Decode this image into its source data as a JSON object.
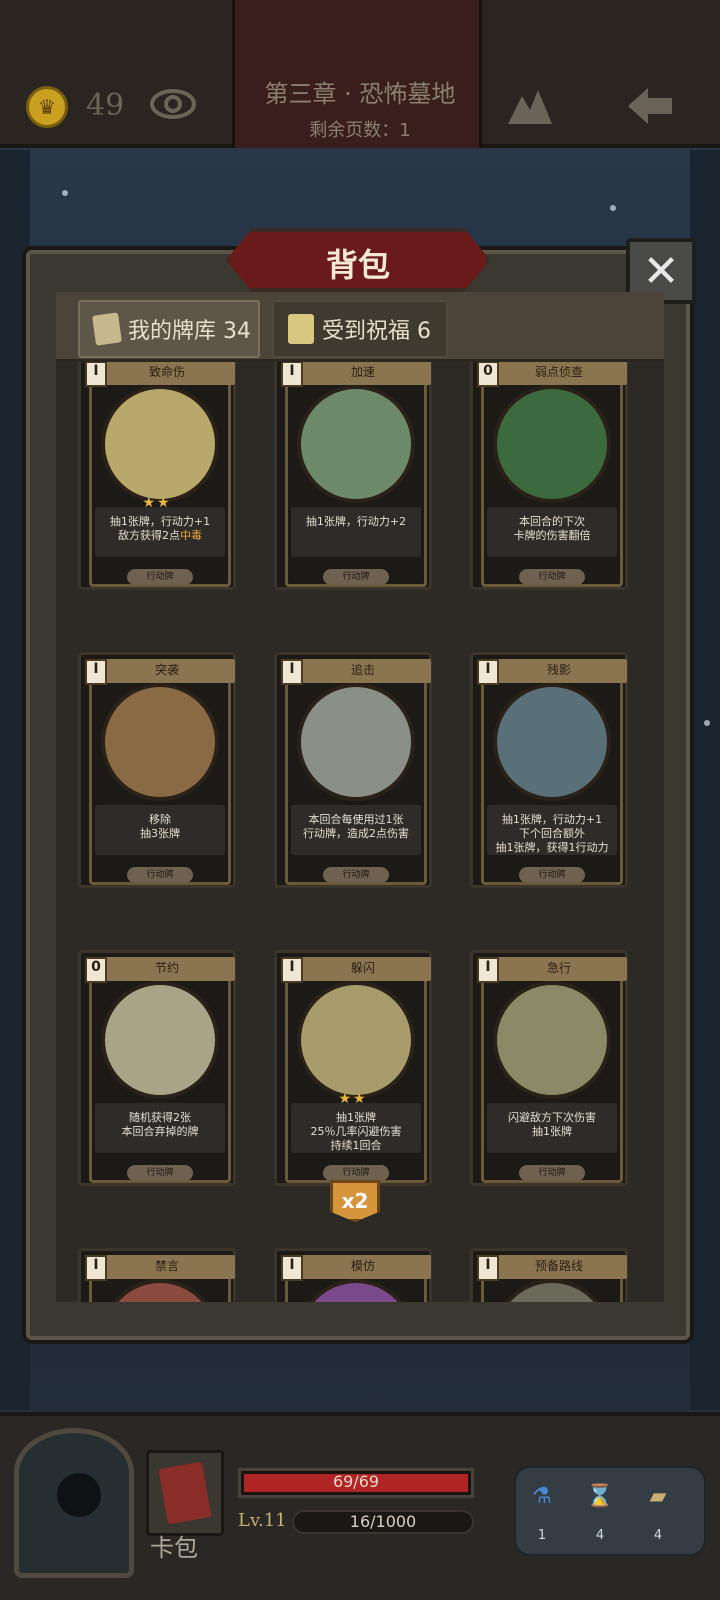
{
  "top_bar": {
    "coins": "49",
    "chapter_title": "第三章 · 恐怖墓地",
    "pages_left": "剩余页数：1"
  },
  "dialog": {
    "title": "背包",
    "tabs": [
      {
        "label": "我的牌库 34"
      },
      {
        "label": "受到祝福 6"
      }
    ]
  },
  "cards": [
    {
      "name": "致命伤",
      "cost": "I",
      "stars": "★★",
      "desc": "抽1张牌，行动力+1\n敌方获得2点",
      "desc_hl": "中毒",
      "type": "行动牌",
      "art": "#b8a86c"
    },
    {
      "name": "加速",
      "cost": "I",
      "stars": "",
      "desc": "抽1张牌，行动力+2",
      "desc_hl": "",
      "type": "行动牌",
      "art": "#6c8a6a"
    },
    {
      "name": "弱点侦查",
      "cost": "0",
      "stars": "",
      "desc": "本回合的下次\n卡牌的伤害翻倍",
      "desc_hl": "",
      "type": "行动牌",
      "art": "#3a6a3e"
    },
    {
      "name": "突袭",
      "cost": "I",
      "stars": "",
      "desc": "移除\n抽3张牌",
      "desc_hl": "",
      "type": "行动牌",
      "art": "#8a6a44"
    },
    {
      "name": "追击",
      "cost": "I",
      "stars": "",
      "desc": "本回合每使用过1张\n行动牌，造成2点伤害",
      "desc_hl": "",
      "type": "行动牌",
      "art": "#8a9088"
    },
    {
      "name": "残影",
      "cost": "I",
      "stars": "",
      "desc": "抽1张牌，行动力+1\n下个回合额外\n抽1张牌，获得1行动力",
      "desc_hl": "",
      "type": "行动牌",
      "art": "#5a7078"
    },
    {
      "name": "节约",
      "cost": "0",
      "stars": "",
      "desc": "随机获得2张\n本回合弃掉的牌",
      "desc_hl": "",
      "type": "行动牌",
      "art": "#a8a488"
    },
    {
      "name": "躲闪",
      "cost": "I",
      "stars": "★★",
      "desc": "抽1张牌\n25％几率闪避伤害\n持续1回合",
      "desc_hl": "",
      "type": "行动牌",
      "art": "#a89c6c"
    },
    {
      "name": "急行",
      "cost": "I",
      "stars": "",
      "desc": "闪避敌方下次伤害\n抽1张牌",
      "desc_hl": "",
      "type": "行动牌",
      "art": "#8a8a66"
    },
    {
      "name": "禁言",
      "cost": "I",
      "stars": "",
      "desc": "",
      "desc_hl": "",
      "type": "",
      "art": "#8a4a40"
    },
    {
      "name": "模仿",
      "cost": "I",
      "stars": "",
      "desc": "",
      "desc_hl": "",
      "type": "",
      "art": "#7a4a8a"
    },
    {
      "name": "预备路线",
      "cost": "I",
      "stars": "",
      "desc": "",
      "desc_hl": "",
      "type": "",
      "art": "#6a6a5a"
    }
  ],
  "duplicate_badge": "x2",
  "hud": {
    "card_bag_label": "卡包",
    "hp": "69/69",
    "hp_fraction": 1.0,
    "level": "Lv.11",
    "xp": "16/1000",
    "xp_fraction": 0.016,
    "resources": [
      {
        "icon": "potion-icon",
        "value": "1"
      },
      {
        "icon": "hourglass-icon",
        "value": "4"
      },
      {
        "icon": "cards-icon",
        "value": "4"
      }
    ]
  },
  "colors": {
    "accent_red": "#6a1a18",
    "gold": "#c9a020",
    "highlight": "#e8a63a",
    "hp_red": "#b02424"
  }
}
